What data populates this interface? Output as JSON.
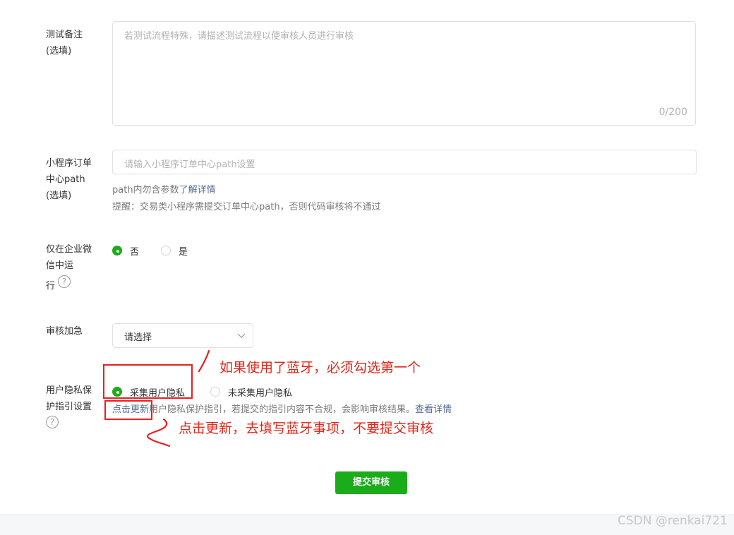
{
  "test_notes": {
    "label_line1": "测试备注",
    "label_line2": "(选填)",
    "placeholder": "若测试流程特殊，请描述测试流程以便审核人员进行审核",
    "counter": "0/200"
  },
  "order_path": {
    "label_line1": "小程序订单",
    "label_line2": "中心path",
    "label_line3": "(选填)",
    "placeholder": "请输入小程序订单中心path设置",
    "hint_prefix": "path内勿含参数",
    "hint_link": "了解详情",
    "reminder": "提醒：交易类小程序需提交订单中心path，否则代码审核将不通过"
  },
  "wecom_only": {
    "label_line1": "仅在企业微",
    "label_line2": "信中运",
    "label_line3": "行",
    "options": [
      "否",
      "是"
    ],
    "selected_index": 0
  },
  "expedite": {
    "label": "审核加急",
    "select_value": "请选择"
  },
  "privacy": {
    "label_line1": "用户隐私保",
    "label_line2": "护指引设置",
    "options": [
      "采集用户隐私",
      "未采集用户隐私"
    ],
    "selected_index": 0,
    "update_link": "点击更新",
    "description": "用户隐私保护指引，若提交的指引内容不合规，会影响审核结果。",
    "details_link": "查看详情"
  },
  "submit_label": "提交审核",
  "annotations": {
    "note1": "如果使用了蓝牙，必须勾选第一个",
    "note2": "点击更新，去填写蓝牙事项，不要提交审核"
  },
  "watermark": "CSDN @renkai721",
  "colors": {
    "accent_green": "#1aad19",
    "link_blue": "#576b95",
    "annotation_red": "#e0261a"
  }
}
